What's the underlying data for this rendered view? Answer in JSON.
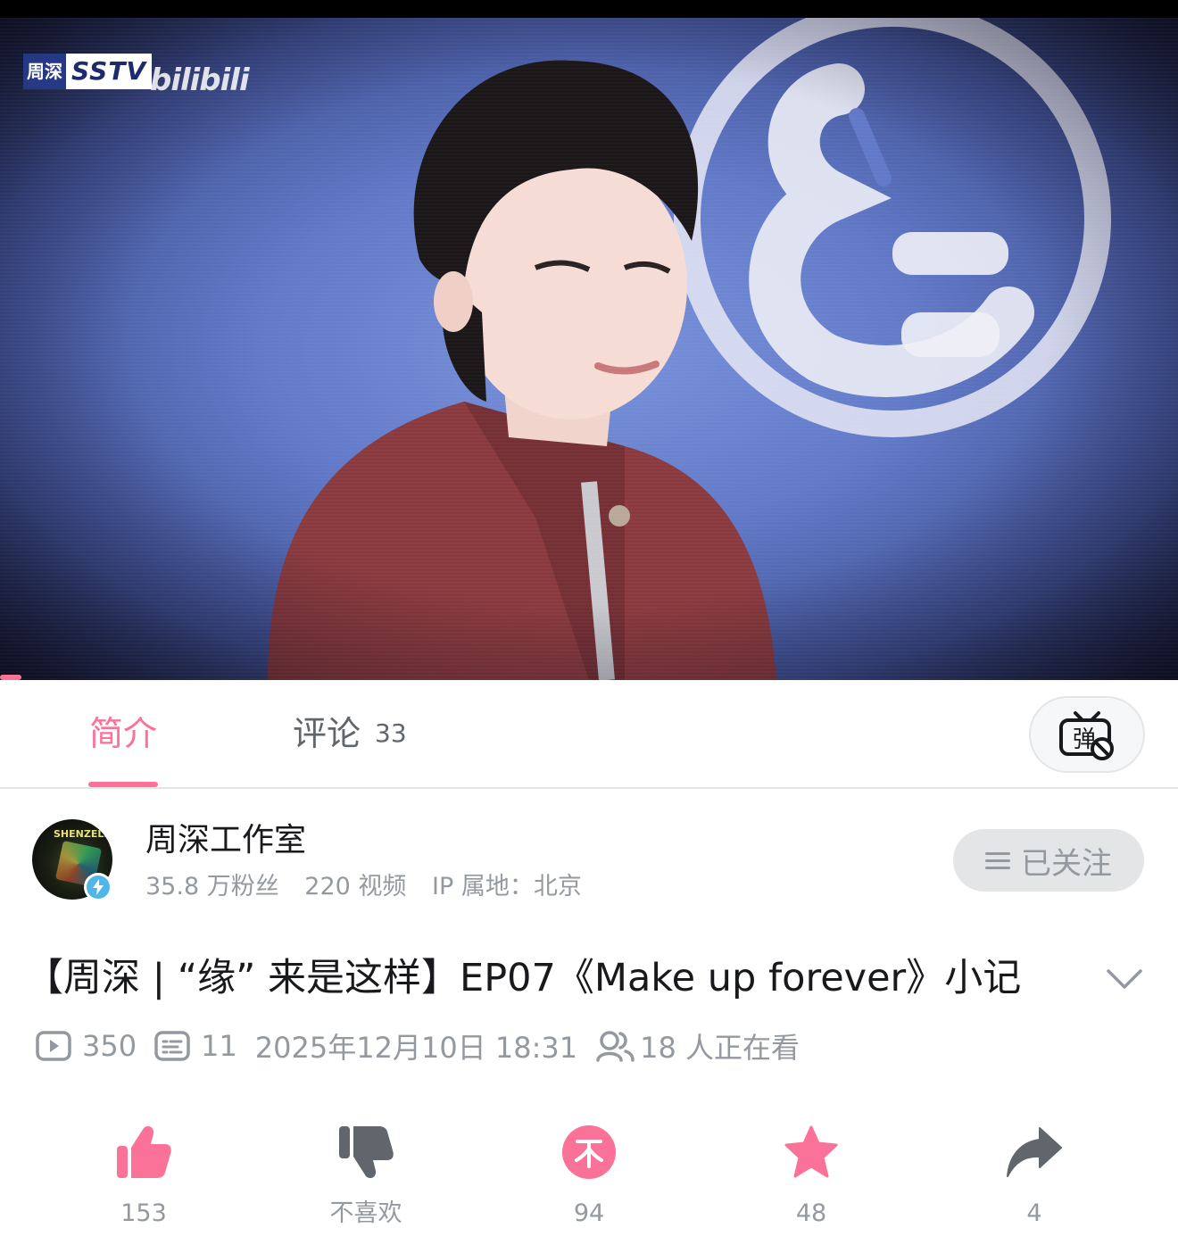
{
  "video": {
    "channel_logo_cn": "周深",
    "channel_logo_sstv": "SSTV",
    "watermark": "bilibili"
  },
  "tabs": {
    "intro_label": "简介",
    "comments_label": "评论",
    "comments_count": "33",
    "danmaku_icon": "danmaku-off-icon",
    "danmaku_char": "弹"
  },
  "uploader": {
    "name": "周深工作室",
    "avatar_text": "SHENZELF",
    "followers": "35.8 万粉丝",
    "videos": "220 视频",
    "ip": "IP 属地：北京",
    "follow_label": "已关注"
  },
  "video_info": {
    "title": "【周深 | “缘” 来是这样】EP07《Make up forever》小记",
    "views": "350",
    "danmaku_count": "11",
    "publish_time": "2025年12月10日 18:31",
    "watching": "18 人正在看"
  },
  "actions": {
    "like": "153",
    "dislike": "不喜欢",
    "coin": "94",
    "favorite": "48",
    "share": "4"
  },
  "colors": {
    "accent": "#fb7299",
    "text_primary": "#18191c",
    "text_secondary": "#9499a0",
    "icon_gray": "#61666d"
  }
}
